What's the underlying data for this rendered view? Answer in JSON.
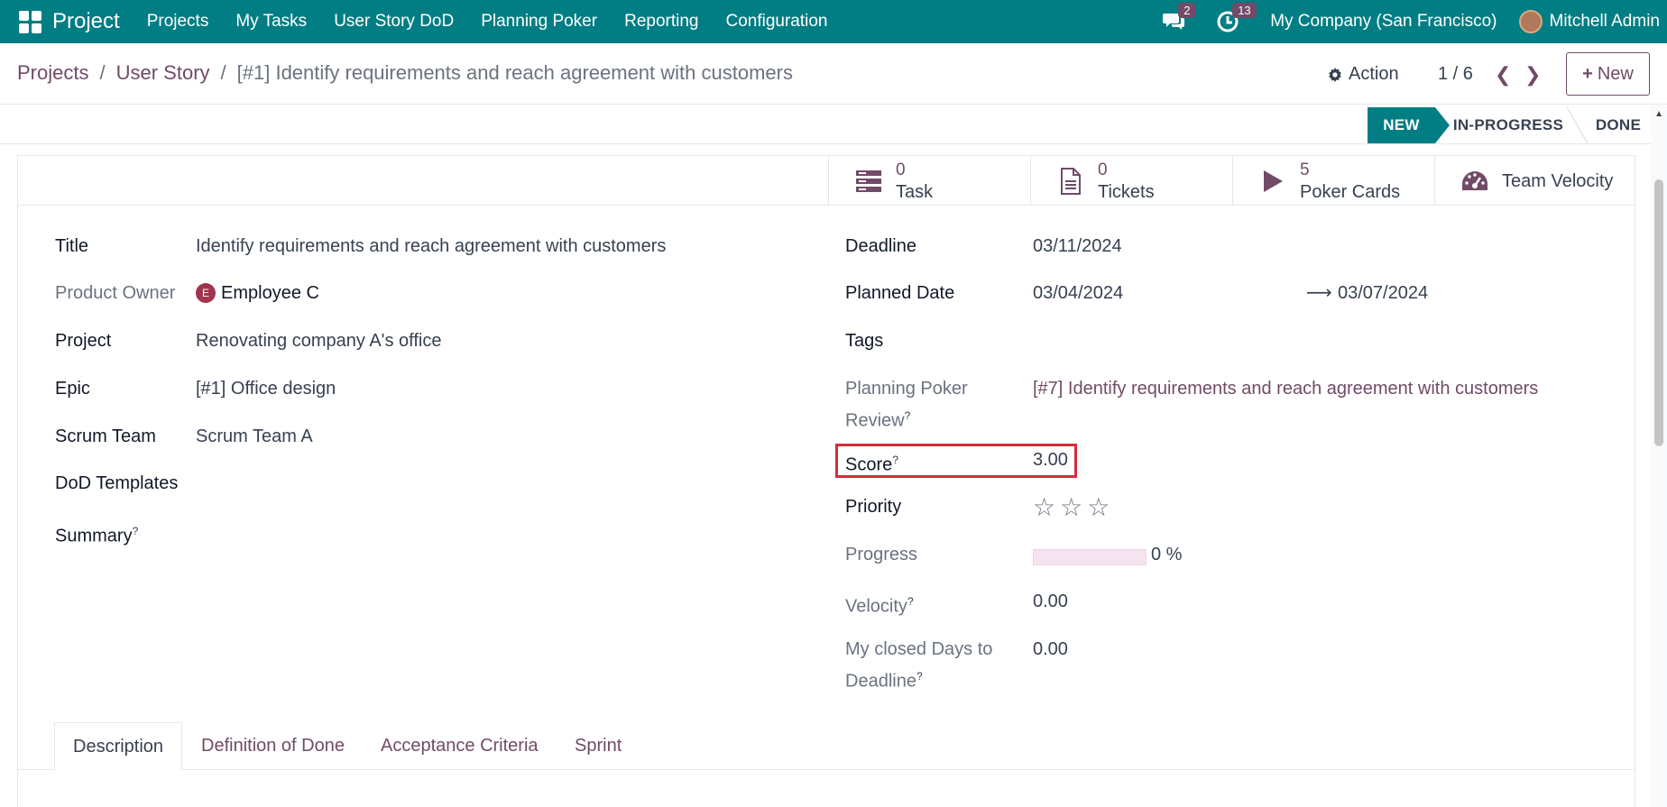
{
  "navbar": {
    "app_name": "Project",
    "menu": [
      "Projects",
      "My Tasks",
      "User Story DoD",
      "Planning Poker",
      "Reporting",
      "Configuration"
    ],
    "messages_count": "2",
    "activities_count": "13",
    "company": "My Company (San Francisco)",
    "user": "Mitchell Admin",
    "accent": "#017e84"
  },
  "control": {
    "breadcrumb": [
      "Projects",
      "User Story"
    ],
    "current": "[#1] Identify requirements and reach agreement with customers",
    "action_label": "Action",
    "pager": "1 / 6",
    "new_label": "New"
  },
  "status": {
    "stages": [
      "NEW",
      "IN-PROGRESS",
      "DONE"
    ],
    "current": "NEW"
  },
  "smart_buttons": [
    {
      "value": "0",
      "label": "Task",
      "icon": "tasks-icon"
    },
    {
      "value": "0",
      "label": "Tickets",
      "icon": "file-text-icon"
    },
    {
      "value": "5",
      "label": "Poker Cards",
      "icon": "play-icon"
    },
    {
      "value": "",
      "label": "Team Velocity",
      "icon": "dashboard-icon"
    }
  ],
  "left_fields": {
    "title_label": "Title",
    "title": "Identify requirements and reach agreement with customers",
    "product_owner_label": "Product Owner",
    "product_owner_initial": "E",
    "product_owner": "Employee C",
    "project_label": "Project",
    "project": "Renovating company A's office",
    "epic_label": "Epic",
    "epic": "[#1] Office design",
    "scrum_team_label": "Scrum Team",
    "scrum_team": "Scrum Team A",
    "dod_label": "DoD Templates",
    "summary_label": "Summary"
  },
  "right_fields": {
    "deadline_label": "Deadline",
    "deadline": "03/11/2024",
    "planned_label": "Planned Date",
    "planned_start": "03/04/2024",
    "planned_end": "03/07/2024",
    "tags_label": "Tags",
    "poker_label_1": "Planning Poker",
    "poker_label_2": "Review",
    "poker_review": "[#7] Identify requirements and reach agreement with customers",
    "score_label": "Score",
    "score": "3.00",
    "priority_label": "Priority",
    "priority_stars": 0,
    "progress_label": "Progress",
    "progress": "0 %",
    "progress_fraction": 0,
    "velocity_label": "Velocity",
    "velocity": "0.00",
    "closed_label_1": "My closed Days to",
    "closed_label_2": "Deadline",
    "closed_days": "0.00",
    "help_mark": "?"
  },
  "tabs": [
    "Description",
    "Definition of Done",
    "Acceptance Criteria",
    "Sprint"
  ],
  "active_tab": "Description"
}
